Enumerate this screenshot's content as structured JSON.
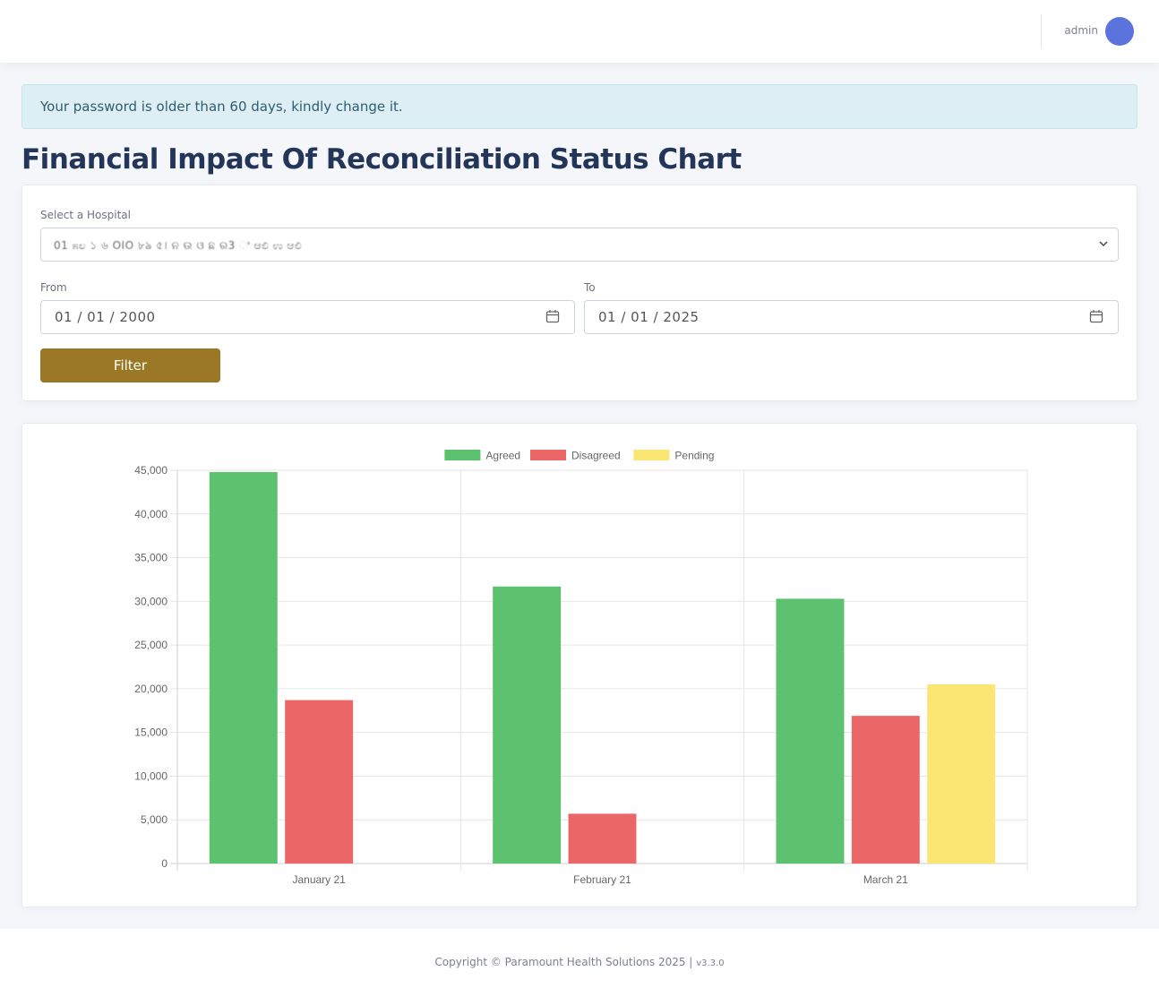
{
  "header": {
    "username": "admin"
  },
  "alert": {
    "message": "Your password is older than 60 days, kindly change it."
  },
  "page": {
    "title": "Financial Impact Of Reconciliation Status Chart"
  },
  "filters": {
    "hospital_label": "Select a Hospital",
    "hospital_value": "01 ೫ಲ ১ ৬ OIO ৮ঌ ৫। ନ ଉ ଓ ଛ ର3 ಿ ಆಲಿ ಉ ಆಲಿ",
    "from_label": "From",
    "from_value": "01 / 01 / 2000",
    "to_label": "To",
    "to_value": "01 / 01 / 2025",
    "filter_button": "Filter"
  },
  "chart_data": {
    "type": "bar",
    "categories": [
      "January 21",
      "February 21",
      "March 21"
    ],
    "series": [
      {
        "name": "Agreed",
        "color": "#5cc26f",
        "values": [
          44800,
          31700,
          30300
        ]
      },
      {
        "name": "Disagreed",
        "color": "#eb6666",
        "values": [
          18700,
          5700,
          16900
        ]
      },
      {
        "name": "Pending",
        "color": "#fbe573",
        "values": [
          0,
          0,
          20500
        ]
      }
    ],
    "ylim": [
      0,
      45000
    ],
    "yticks": [
      "0",
      "5,000",
      "10,000",
      "15,000",
      "20,000",
      "25,000",
      "30,000",
      "35,000",
      "40,000",
      "45,000"
    ],
    "legend_position": "top",
    "grid": true
  },
  "footer": {
    "copyright": "Copyright © Paramount Health Solutions 2025 |",
    "version": "v3.3.0"
  }
}
